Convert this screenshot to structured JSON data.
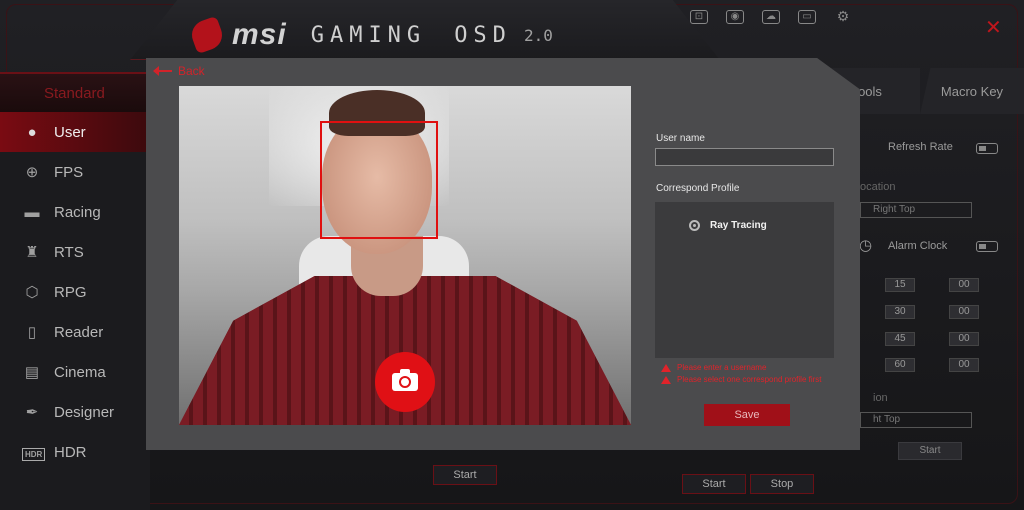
{
  "header": {
    "brand": "msi",
    "product_word1": "GAMING",
    "product_word2": "OSD",
    "version": "2.0",
    "close_glyph": "✕"
  },
  "top_icons": [
    {
      "name": "screenshot-icon",
      "glyph": "⊡"
    },
    {
      "name": "capture-icon",
      "glyph": "◉"
    },
    {
      "name": "cloud-icon",
      "glyph": "☁"
    },
    {
      "name": "monitor-icon",
      "glyph": "▭"
    },
    {
      "name": "gear-icon",
      "glyph": "⚙"
    }
  ],
  "sidebar": {
    "heading": "Standard",
    "items": [
      {
        "label": "User",
        "icon": "user-icon",
        "glyph": "👤",
        "active": true
      },
      {
        "label": "FPS",
        "icon": "crosshair-icon",
        "glyph": "⊕",
        "active": false
      },
      {
        "label": "Racing",
        "icon": "car-icon",
        "glyph": "▬",
        "active": false
      },
      {
        "label": "RTS",
        "icon": "rook-icon",
        "glyph": "♜",
        "active": false
      },
      {
        "label": "RPG",
        "icon": "cube-icon",
        "glyph": "⬡",
        "active": false
      },
      {
        "label": "Reader",
        "icon": "book-icon",
        "glyph": "📖",
        "active": false
      },
      {
        "label": "Cinema",
        "icon": "film-icon",
        "glyph": "🎞",
        "active": false
      },
      {
        "label": "Designer",
        "icon": "pen-icon",
        "glyph": "✒",
        "active": false
      },
      {
        "label": "HDR",
        "icon": "hdr-icon",
        "glyph": "HDR",
        "active": false
      }
    ]
  },
  "right_tabs": [
    {
      "label": "ools"
    },
    {
      "label": "Macro Key"
    }
  ],
  "right_panel": {
    "refresh_rate_label": "Refresh Rate",
    "location_label": "ocation",
    "location_value": "Right Top",
    "alarm_clock_label": "Alarm Clock",
    "times": [
      {
        "a": "15",
        "b": "00"
      },
      {
        "a": "30",
        "b": "00"
      },
      {
        "a": "45",
        "b": "00"
      },
      {
        "a": "60",
        "b": "00"
      }
    ],
    "location2_label": "ion",
    "location2_value": "ht Top",
    "start_label": "Start"
  },
  "bottom_buttons": {
    "start_left": "Start",
    "start_right": "Start",
    "stop": "Stop"
  },
  "modal": {
    "back_label": "Back",
    "username_label": "User name",
    "username_value": "",
    "profile_label": "Correspond Profile",
    "profiles": [
      {
        "label": "Ray Tracing"
      }
    ],
    "errors": [
      "Please enter a username",
      "Please select one correspond profile first"
    ],
    "save_label": "Save"
  },
  "colors": {
    "accent": "#d2232a",
    "active_nav": "#7a0b12",
    "modal_bg": "#4b4b4d"
  }
}
